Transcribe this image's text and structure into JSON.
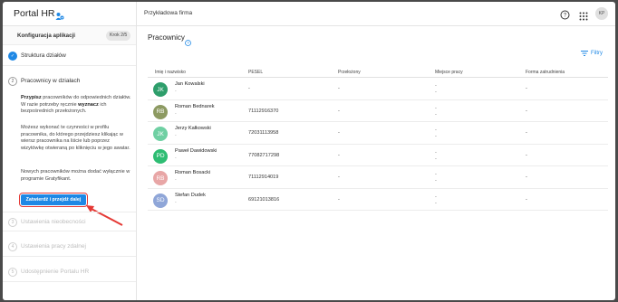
{
  "header": {
    "app_title": "Portal HR",
    "company": "Przykładowa firma",
    "user_initials": "KP"
  },
  "sidebar": {
    "config_label": "Konfiguracja aplikacji",
    "step_counter": "Krok 2/5",
    "steps": [
      {
        "number": "✓",
        "label": "Struktura działów",
        "state": "done"
      },
      {
        "number": "2",
        "label": "Pracownicy w działach",
        "state": "current"
      },
      {
        "number": "3",
        "label": "Ustawienia nieobecności",
        "state": "future"
      },
      {
        "number": "4",
        "label": "Ustawienia pracy zdalnej",
        "state": "future"
      },
      {
        "number": "5",
        "label": "Udostępnienie Portalu HR",
        "state": "future"
      }
    ],
    "description": {
      "p1_a": "Przypisz",
      "p1_b": " pracowników do odpowiednich działów. W razie potrzeby ręcznie ",
      "p1_c": "wyznacz",
      "p1_d": " ich bezpośrednich przełożonych.",
      "p2": "Możesz wykonać te czynności w profilu pracownika, do którego przejdziesz klikając w wiersz pracownika na liście lub poprzez wizytówkę otwieraną po kliknięciu w jego awatar.",
      "p3": "Nowych pracowników można dodać wyłącznie w programie Gratyfikant."
    },
    "confirm_button": "Zatwierdź i przejdź dalej"
  },
  "main": {
    "title": "Pracownicy",
    "filter_label": "Filtry",
    "columns": [
      "Imię i nazwisko",
      "PESEL",
      "Przełożony",
      "Miejsce pracy",
      "Forma zatrudnienia"
    ],
    "rows": [
      {
        "initials": "JK",
        "name": "Jan Kowalski",
        "sub": "-",
        "pesel": "-",
        "supervisor": "-",
        "workplace_top": "-",
        "workplace_bottom": "-",
        "employment": "-",
        "color": "#2e9e6b"
      },
      {
        "initials": "RB",
        "name": "Roman Bednarek",
        "sub": "-",
        "pesel": "71112916370",
        "supervisor": "-",
        "workplace_top": "-",
        "workplace_bottom": "-",
        "employment": "-",
        "color": "#8d9a62"
      },
      {
        "initials": "JK",
        "name": "Jerzy Kałkowski",
        "sub": "-",
        "pesel": "72031113958",
        "supervisor": "-",
        "workplace_top": "-",
        "workplace_bottom": "-",
        "employment": "-",
        "color": "#6fd0a3"
      },
      {
        "initials": "PD",
        "name": "Paweł Dawidowski",
        "sub": "-",
        "pesel": "77082717298",
        "supervisor": "-",
        "workplace_top": "-",
        "workplace_bottom": "-",
        "employment": "-",
        "color": "#2ebd73"
      },
      {
        "initials": "RB",
        "name": "Roman Bosacki",
        "sub": "-",
        "pesel": "71112914019",
        "supervisor": "-",
        "workplace_top": "-",
        "workplace_bottom": "-",
        "employment": "-",
        "color": "#e8a6a6"
      },
      {
        "initials": "SD",
        "name": "Stefan Dudek",
        "sub": "-",
        "pesel": "69121013816",
        "supervisor": "-",
        "workplace_top": "-",
        "workplace_bottom": "-",
        "employment": "-",
        "color": "#8fa6d8"
      }
    ]
  },
  "colors": {
    "accent": "#1e88e5",
    "highlight": "#e53935"
  }
}
